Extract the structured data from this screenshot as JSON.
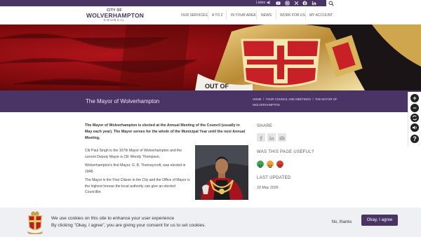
{
  "topbar": {
    "listen_label": "Listen ◀)",
    "social_icons": [
      "youtube-icon",
      "instagram-icon",
      "x-icon",
      "facebook-icon",
      "linkedin-icon"
    ]
  },
  "logo": {
    "line1": "CITY OF",
    "line2": "WOLVERHAMPTON",
    "line3": "COUNCIL"
  },
  "nav": {
    "items": [
      "OUR SERVICES",
      "A TO Z",
      "IN YOUR AREA",
      "NEWS",
      "WORK FOR US",
      "MY ACCOUNT"
    ]
  },
  "hero": {
    "banner_text": "OUT OF"
  },
  "band": {
    "title": "The Mayor of Wolverhampton",
    "breadcrumb": [
      "HOME",
      "YOUR COUNCIL AND MEETINGS",
      "THE MAYOR OF WOLVERHAMPTON"
    ],
    "crumb_sep": "/"
  },
  "content": {
    "intro": "The Mayor of Wolverhampton is elected at the Annual Meeting of the Council (usually in May each year). The Mayor serves for the whole of the Municipal Year until the next Annual Meeting.",
    "p1": "Cllr Paul Singh is the 167th Mayor of Wolverhampton and the current Deputy Mayor is Cllr Wendy Thompson.",
    "p2": "Wolverhampton's first Mayor, G. B. Thorneycroft, was elected in 1848.",
    "p3": "The Mayor is the First Citizen in the City and the Office of Mayor is the highest honour the local authority can give an elected Councillor."
  },
  "side": {
    "share_heading": "SHARE",
    "share_icons": [
      "facebook-icon",
      "linkedin-icon",
      "email-icon"
    ],
    "feedback_heading": "WAS THIS PAGE USEFUL?",
    "updated_heading": "LAST UPDATED",
    "updated_value": "20 May 2026"
  },
  "tools": {
    "zoom_in": "+",
    "zoom_out": "−",
    "help": "?"
  },
  "cookie": {
    "line1": "We use cookies on this site to enhance your user experience",
    "line2": "By clicking \"Okay, I agree\", you are giving your consent for us to set cookies.",
    "decline_label": "No, thanks",
    "accept_label": "Okay, I agree"
  },
  "colors": {
    "brand_purple": "#4a3466",
    "hero_red": "#8a0c0c",
    "good": "#3aa655",
    "neutral": "#e9a23b",
    "bad": "#d2392f"
  }
}
